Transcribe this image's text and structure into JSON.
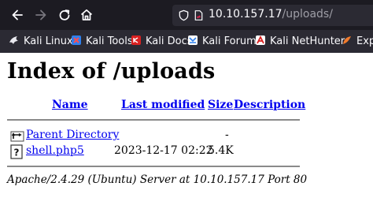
{
  "browser": {
    "url_host": "10.10.157.17",
    "url_path": "/uploads/",
    "icons": {
      "back": "arrow-left-icon",
      "forward": "arrow-right-icon",
      "reload": "reload-icon",
      "home": "home-icon",
      "security": "shield-icon",
      "page_info": "page-info-icon"
    },
    "colors": {
      "toolbar_bg": "#1c1b22",
      "urlbar_bg": "#2b2a33",
      "text": "#fbfbfe"
    }
  },
  "bookmarks": [
    {
      "label": "Kali Linux",
      "icon": "kali-dragon-icon"
    },
    {
      "label": "Kali Tools",
      "icon": "kali-tools-icon"
    },
    {
      "label": "Kali Docs",
      "icon": "kali-docs-icon"
    },
    {
      "label": "Kali Forums",
      "icon": "kali-forums-icon"
    },
    {
      "label": "Kali NetHunter",
      "icon": "nethunter-icon"
    },
    {
      "label": "Expla",
      "icon": "exploit-db-icon"
    }
  ],
  "page": {
    "title": "Index of /uploads",
    "columns": [
      "Name",
      "Last modified",
      "Size",
      "Description"
    ],
    "rows": [
      {
        "name": "Parent Directory",
        "modified": "",
        "size": "-",
        "description": "",
        "icon": "back-folder-icon"
      },
      {
        "name": "shell.php5",
        "modified": "2023-12-17 02:22",
        "size": "5.4K",
        "description": "",
        "icon": "unknown-file-icon"
      }
    ],
    "footer": "Apache/2.4.29 (Ubuntu) Server at 10.10.157.17 Port 80",
    "colors": {
      "link": "#0000ee",
      "rule": "#8a8a8a"
    }
  }
}
